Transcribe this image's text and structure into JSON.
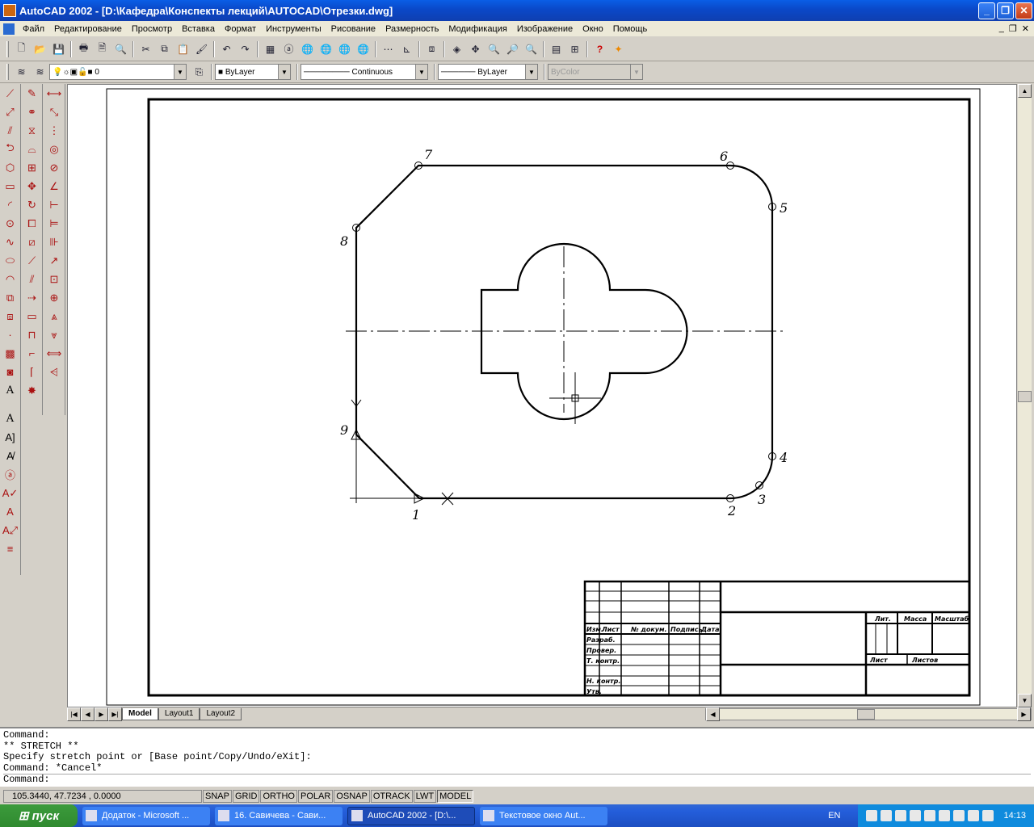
{
  "window": {
    "title": "AutoCAD 2002 - [D:\\Кафедра\\Конспекты лекций\\AUTOCAD\\Отрезки.dwg]"
  },
  "menu": [
    "Файл",
    "Редактирование",
    "Просмотр",
    "Вставка",
    "Формат",
    "Инструменты",
    "Рисование",
    "Размерность",
    "Модификация",
    "Изображение",
    "Окно",
    "Помощь"
  ],
  "properties": {
    "layer": "0",
    "color": "ByLayer",
    "linetype": "Continuous",
    "lineweight": "ByLayer",
    "plotstyle": "ByColor"
  },
  "drawing": {
    "point_labels": [
      "1",
      "2",
      "3",
      "4",
      "5",
      "6",
      "7",
      "8",
      "9"
    ],
    "title_block": {
      "cells": [
        "Изм.",
        "Лист",
        "№ докум.",
        "Подпись",
        "Дата",
        "Разраб.",
        "Провер.",
        "Т. контр.",
        "Н. контр.",
        "Утв.",
        "Лит.",
        "Масса",
        "Масштаб",
        "Лист",
        "Листов"
      ]
    }
  },
  "tabs": [
    "Model",
    "Layout1",
    "Layout2"
  ],
  "command_lines": [
    "Command:",
    "** STRETCH **",
    "Specify stretch point or [Base point/Copy/Undo/eXit]:",
    "Command: *Cancel*",
    "Command:"
  ],
  "status": {
    "coords": "105.3440, 47.7234 , 0.0000",
    "toggles": [
      "SNAP",
      "GRID",
      "ORTHO",
      "POLAR",
      "OSNAP",
      "OTRACK",
      "LWT",
      "MODEL"
    ]
  },
  "taskbar": {
    "start": "пуск",
    "tasks": [
      "Додаток - Microsoft ...",
      "16. Савичева - Сави...",
      "AutoCAD 2002 - [D:\\...",
      "Текстовое окно Aut..."
    ],
    "lang": "EN",
    "clock": "14:13"
  }
}
